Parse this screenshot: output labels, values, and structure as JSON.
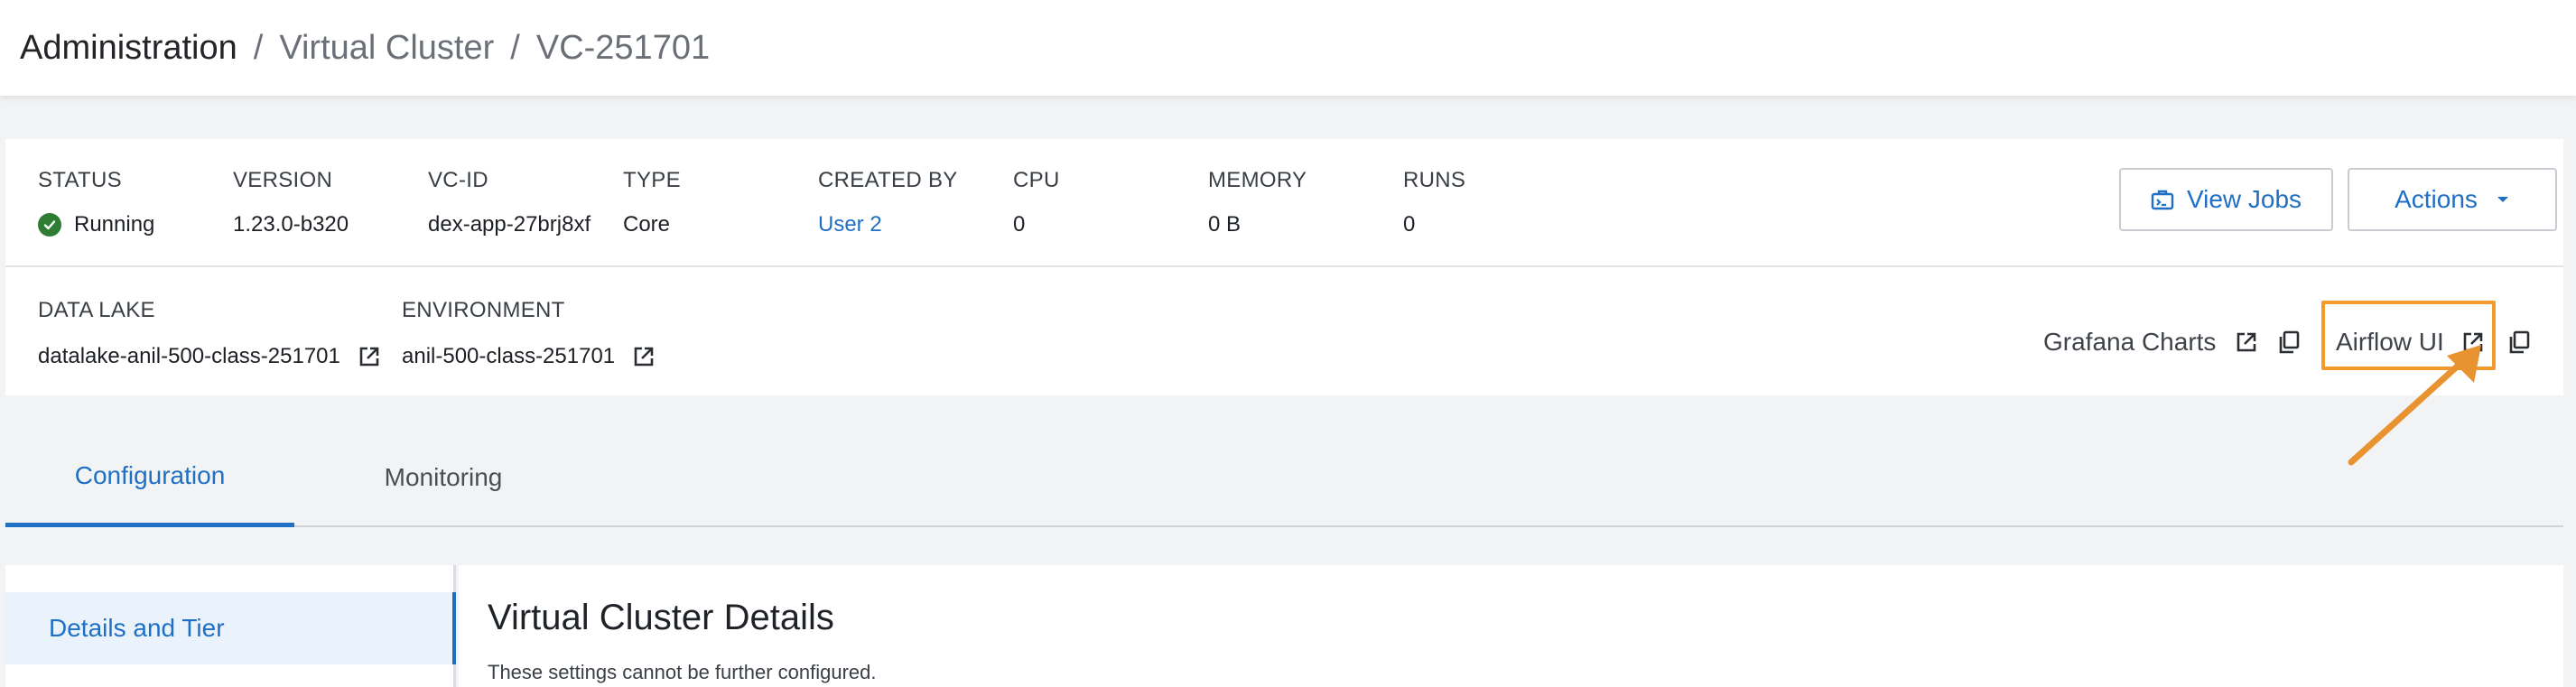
{
  "breadcrumb": {
    "root": "Administration",
    "separator": "/",
    "section": "Virtual Cluster",
    "current": "VC-251701"
  },
  "summary": {
    "status": {
      "label": "STATUS",
      "value": "Running"
    },
    "version": {
      "label": "VERSION",
      "value": "1.23.0-b320"
    },
    "vc_id": {
      "label": "VC-ID",
      "value": "dex-app-27brj8xf"
    },
    "type": {
      "label": "TYPE",
      "value": "Core"
    },
    "created_by": {
      "label": "CREATED BY",
      "value": "User 2"
    },
    "cpu": {
      "label": "CPU",
      "value": "0"
    },
    "memory": {
      "label": "MEMORY",
      "value": "0 B"
    },
    "runs": {
      "label": "RUNS",
      "value": "0"
    },
    "view_jobs_label": "View Jobs",
    "actions_label": "Actions"
  },
  "links": {
    "data_lake": {
      "label": "DATA LAKE",
      "value": "datalake-anil-500-class-251701"
    },
    "environment": {
      "label": "ENVIRONMENT",
      "value": "anil-500-class-251701"
    },
    "grafana_label": "Grafana Charts",
    "airflow_label": "Airflow UI"
  },
  "tabs": [
    {
      "label": "Configuration",
      "active": true
    },
    {
      "label": "Monitoring",
      "active": false
    }
  ],
  "sidebar": {
    "items": [
      {
        "label": "Details and Tier",
        "active": true
      }
    ]
  },
  "details": {
    "title": "Virtual Cluster Details",
    "subtitle": "These settings cannot be further configured."
  },
  "colors": {
    "accent": "#1f6fc5",
    "status_ok": "#2e7d32",
    "annotation": "#f29a2e"
  },
  "icons": [
    "check-circle-icon",
    "jobs-icon",
    "caret-down-icon",
    "external-link-icon",
    "copy-icon",
    "annotation-arrow"
  ]
}
